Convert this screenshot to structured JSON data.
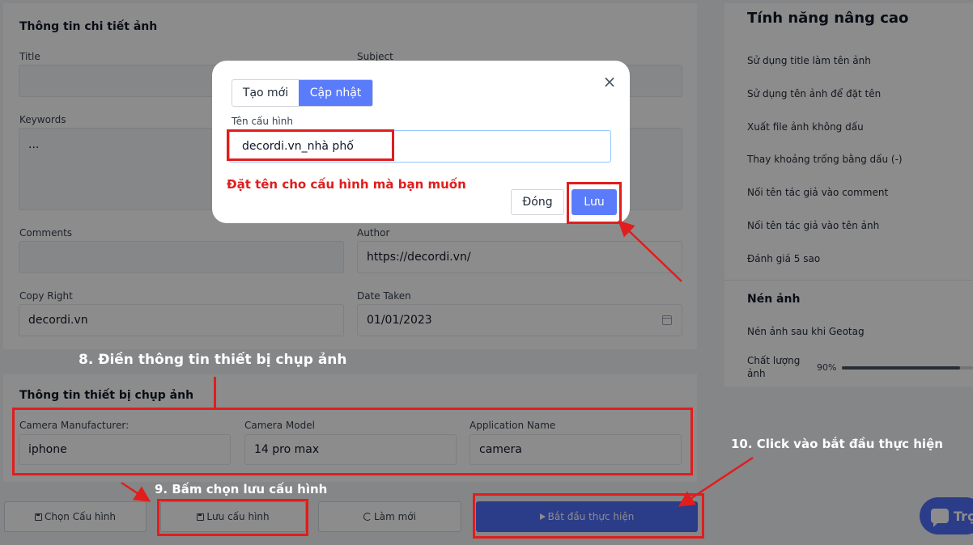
{
  "photo_details": {
    "title": "Thông tin chi tiết ảnh",
    "fields": {
      "title_label": "Title",
      "subject_label": "Subject",
      "keywords_label": "Keywords",
      "keywords_value": "...",
      "comments_label": "Comments",
      "author_label": "Author",
      "author_value": "https://decordi.vn/",
      "copyright_label": "Copy Right",
      "copyright_value": "decordi.vn",
      "date_taken_label": "Date Taken",
      "date_taken_value": "01/01/2023"
    }
  },
  "device_info": {
    "title": "Thông tin thiết bị chụp ảnh",
    "manufacturer_label": "Camera Manufacturer:",
    "manufacturer_value": "iphone",
    "model_label": "Camera Model",
    "model_value": "14 pro max",
    "app_label": "Application Name",
    "app_value": "camera"
  },
  "actions": {
    "choose_config": "Chọn Cấu hình",
    "save_config": "Lưu cấu hình",
    "reset": "Làm mới",
    "start": "Bắt đầu thực hiện"
  },
  "advanced": {
    "title": "Tính năng nâng cao",
    "items": [
      "Sử dụng title làm tên ảnh",
      "Sử dụng tên ảnh để đặt tên",
      "Xuất file ảnh không dấu",
      "Thay khoảng trống bằng dấu (-)",
      "Nối tên tác giả vào comment",
      "Nối tên tác giả vào tên ảnh",
      "Đánh giá 5 sao"
    ],
    "compress_title": "Nén ảnh",
    "compress_item": "Nén ảnh sau khi Geotag",
    "quality_label": "Chất lượng ảnh",
    "quality_value": "90%",
    "quality_fraction": 0.9
  },
  "chat": {
    "label": "Trợ"
  },
  "modal": {
    "tab_new": "Tạo mới",
    "tab_update": "Cập nhật",
    "close_symbol": "×",
    "name_label": "Tên cấu hình",
    "name_value": "decordi.vn_nhà phố",
    "note": "Đặt tên cho cấu hình mà bạn muốn",
    "close_button": "Đóng",
    "save_button": "Lưu"
  },
  "annotations": {
    "step8": "8. Điền thông tin thiết bị chụp ảnh",
    "step9": "9. Bấm chọn lưu cấu hình",
    "step10": "10. Click vào bắt đầu thực hiện"
  },
  "colors": {
    "accent": "#4f6ef7",
    "highlight_red": "#e11d1d"
  }
}
